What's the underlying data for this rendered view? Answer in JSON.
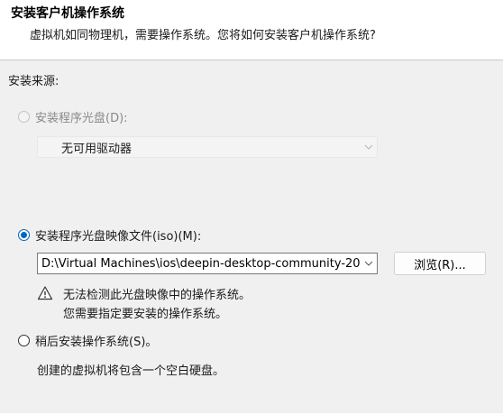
{
  "header": {
    "title": "安装客户机操作系统",
    "subtitle": "虚拟机如同物理机，需要操作系统。您将如何安装客户机操作系统?"
  },
  "source_label": "安装来源:",
  "options": {
    "installer_disc": {
      "label": "安装程序光盘(D):",
      "selected": false,
      "enabled": false,
      "dropdown_value": "无可用驱动器"
    },
    "installer_iso": {
      "label": "安装程序光盘映像文件(iso)(M):",
      "selected": true,
      "enabled": true,
      "path_value": "D:\\Virtual Machines\\ios\\deepin-desktop-community-20",
      "browse_label": "浏览(R)...",
      "warning_line1": "无法检测此光盘映像中的操作系统。",
      "warning_line2": "您需要指定要安装的操作系统。"
    },
    "install_later": {
      "label": "稍后安装操作系统(S)。",
      "selected": false,
      "enabled": true,
      "note": "创建的虚拟机将包含一个空白硬盘。"
    }
  },
  "icons": {
    "warning": "warning-icon",
    "dropdown": "chevron-down-icon"
  },
  "colors": {
    "accent": "#0067c0",
    "background": "#f0f0f0",
    "header_background": "#ffffff"
  }
}
